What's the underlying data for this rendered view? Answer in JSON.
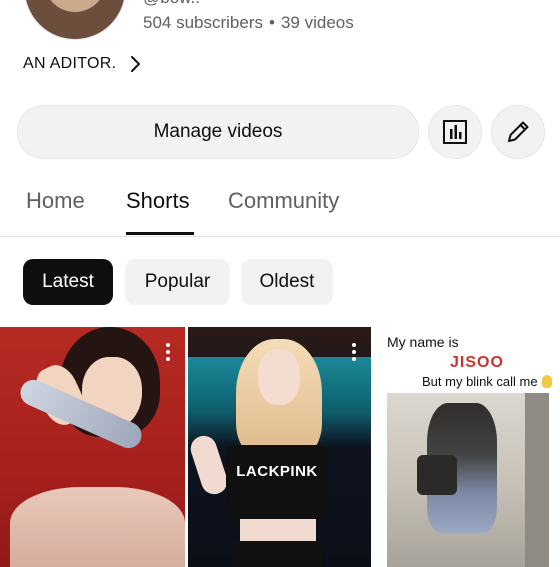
{
  "channel": {
    "handle": "@bow..",
    "subscribers": "504 subscribers",
    "separator": "•",
    "videos": "39 videos",
    "description": "AN ADITOR."
  },
  "actions": {
    "manage_label": "Manage videos",
    "analytics_icon": "analytics-icon",
    "edit_icon": "pencil-icon"
  },
  "tabs": [
    {
      "label": "Home",
      "active": false
    },
    {
      "label": "Shorts",
      "active": true
    },
    {
      "label": "Community",
      "active": false
    }
  ],
  "filters": [
    {
      "label": "Latest",
      "selected": true
    },
    {
      "label": "Popular",
      "selected": false
    },
    {
      "label": "Oldest",
      "selected": false
    }
  ],
  "shorts": [
    {
      "overlay_text": ""
    },
    {
      "overlay_text": "LACKPINK"
    },
    {
      "line1": "My name is",
      "line2": "JISOO",
      "line3": "But my blink call me"
    }
  ],
  "colors": {
    "chip_selected": "#0f0f0f",
    "chip_plain": "#f2f2f2",
    "secondary_text": "#606060",
    "accent_red": "#d0312d"
  }
}
